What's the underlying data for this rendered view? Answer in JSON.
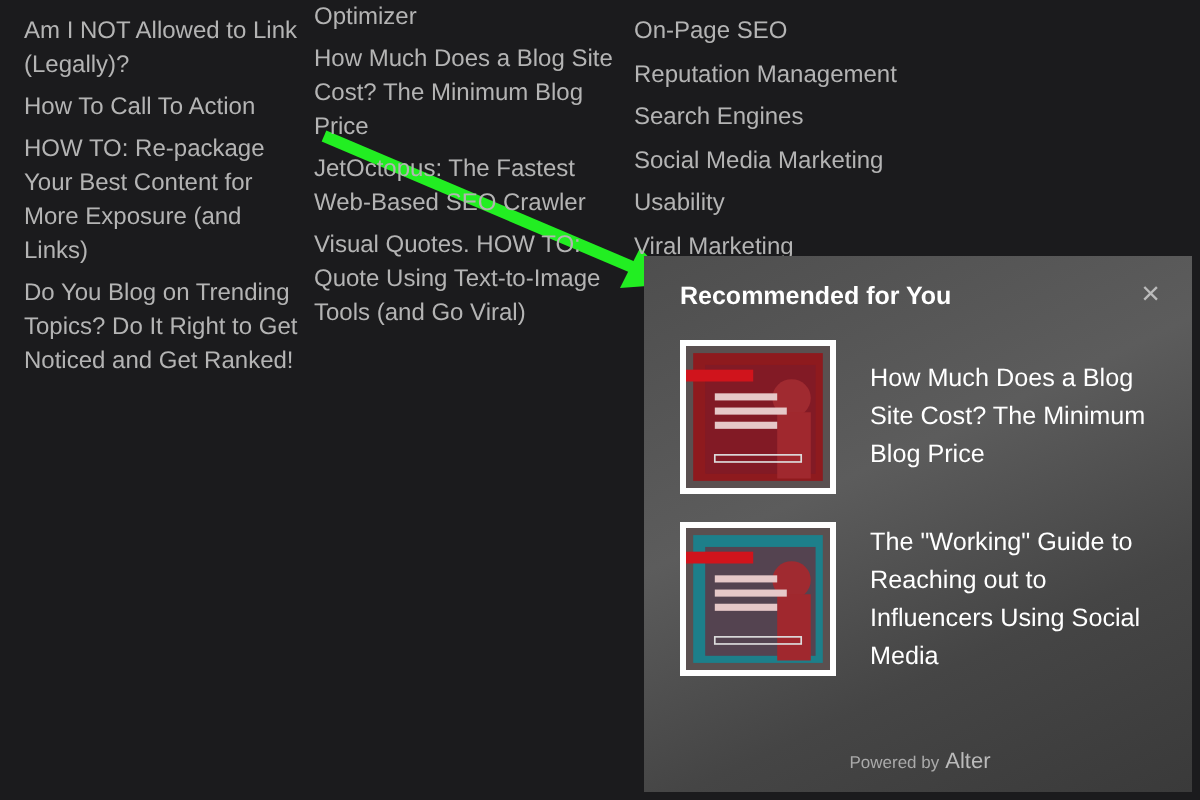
{
  "columns": [
    {
      "links": [
        "Am I NOT Allowed to Link (Legally)?",
        "How To Call To Action",
        "HOW TO: Re-package Your Best Content for More Exposure (and Links)",
        "Do You Blog on Trending Topics? Do It Right to Get Noticed and Get Ranked!"
      ]
    },
    {
      "links": [
        "Optimizer",
        "How Much Does a Blog Site Cost? The Minimum Blog Price",
        "JetOctopus: The Fastest Web-Based SEO Crawler",
        "Visual Quotes. HOW TO: Quote Using Text-to-Image Tools (and Go Viral)"
      ]
    },
    {
      "links": [
        "On-Page SEO",
        "Reputation Management",
        "Search Engines",
        "Social Media Marketing",
        "Usability",
        "Viral Marketing"
      ]
    }
  ],
  "popup": {
    "title": "Recommended for You",
    "close": "×",
    "items": [
      {
        "title": "How Much Does a Blog Site Cost? The Minimum Blog Price",
        "kind": "picture"
      },
      {
        "title": "The \"Working\" Guide to Reaching out to Influencers Using Social Media",
        "kind": "picture"
      }
    ],
    "footer": "Powered by",
    "brand": "Alter"
  }
}
